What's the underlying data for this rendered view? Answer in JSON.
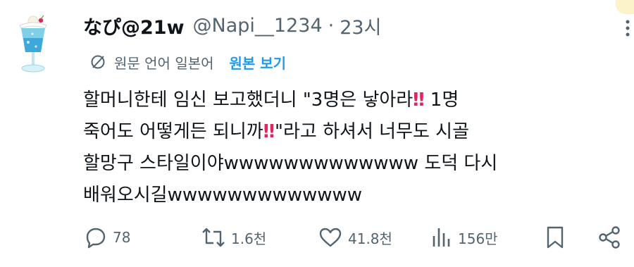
{
  "tweet": {
    "display_name": "なぴ@21w",
    "handle": "@Napi__1234",
    "separator": "·",
    "time": "23시",
    "translation": {
      "label": "원문 언어 일본어",
      "view_original": "원본 보기"
    },
    "text_parts": {
      "p1": "할머니한테 임신 보고했더니 \"3명은 낳아라",
      "bang": "‼",
      "p2": " 1명\n죽어도 어떻게든 되니까",
      "p3": "\"라고 하셔서 너무도 시골\n할망구 스타일이야wwwwwwwwwwwww 도덕 다시\n배워오시길wwwwwwwwwwwww"
    },
    "actions": {
      "replies": "78",
      "retweets": "1.6천",
      "likes": "41.8천",
      "views": "156만"
    }
  },
  "icons": {
    "more": "more-vertical-icon",
    "translate": "translate-icon",
    "reply": "reply-icon",
    "retweet": "retweet-icon",
    "like": "heart-icon",
    "views": "views-icon",
    "bookmark": "bookmark-icon",
    "share": "share-icon"
  },
  "colors": {
    "text": "#0f1419",
    "muted": "#536471",
    "link": "#1d9bf0",
    "emoji": "#e0245e"
  }
}
